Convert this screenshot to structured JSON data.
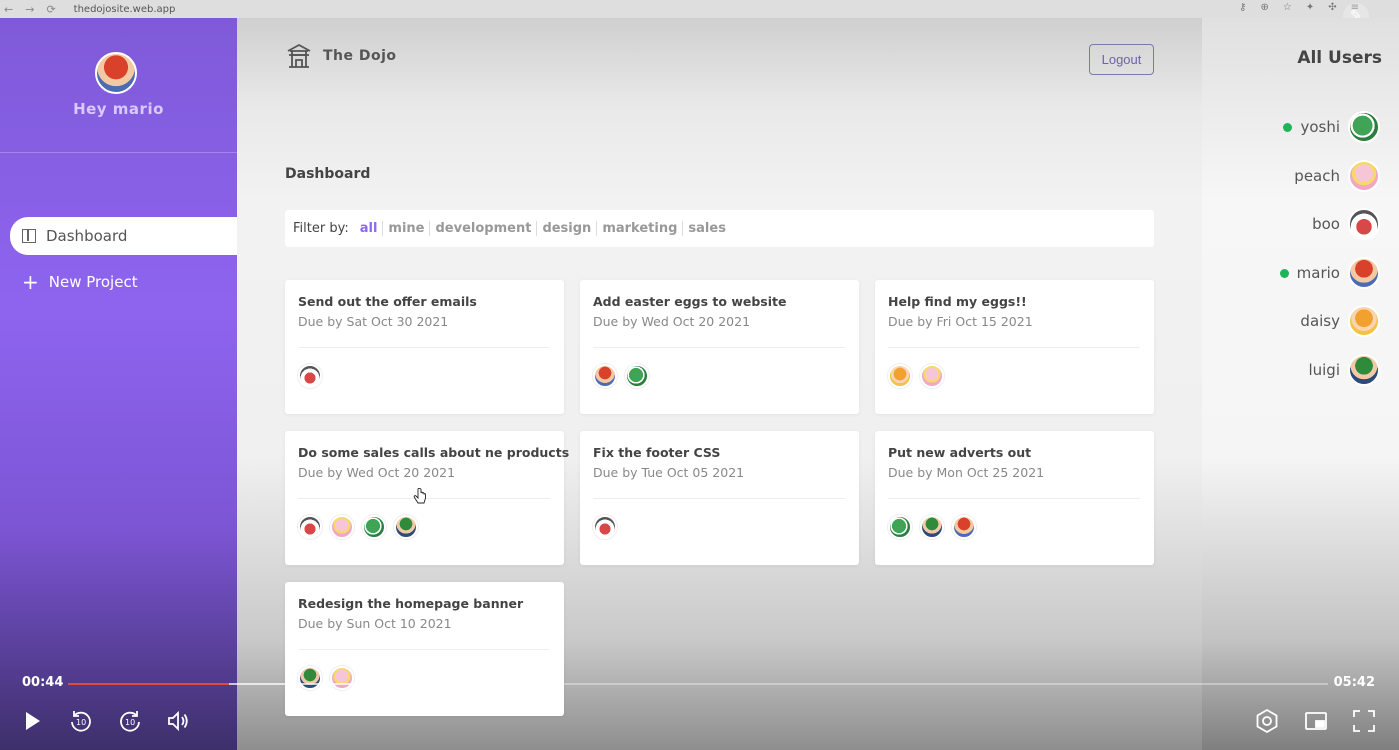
{
  "browser": {
    "url": "thedojosite.web.app"
  },
  "sidebar": {
    "greeting": "Hey mario",
    "nav": [
      {
        "label": "Dashboard",
        "icon": "dashboard-icon",
        "active": true
      },
      {
        "label": "New Project",
        "icon": "plus-icon",
        "active": false
      }
    ]
  },
  "header": {
    "brand": "The Dojo",
    "logout_label": "Logout"
  },
  "main": {
    "title": "Dashboard",
    "filter": {
      "label": "Filter by:",
      "options": [
        "all",
        "mine",
        "development",
        "design",
        "marketing",
        "sales"
      ],
      "active": "all"
    },
    "projects": [
      {
        "title": "Send out the offer emails",
        "due": "Due by Sat Oct 30 2021",
        "assigned": [
          "boo"
        ]
      },
      {
        "title": "Add easter eggs to website",
        "due": "Due by Wed Oct 20 2021",
        "assigned": [
          "mario",
          "yoshi"
        ]
      },
      {
        "title": "Help find my eggs!!",
        "due": "Due by Fri Oct 15 2021",
        "assigned": [
          "daisy",
          "peach"
        ]
      },
      {
        "title": "Do some sales calls about ne products",
        "due": "Due by Wed Oct 20 2021",
        "assigned": [
          "boo",
          "peach",
          "yoshi",
          "luigi"
        ]
      },
      {
        "title": "Fix the footer CSS",
        "due": "Due by Tue Oct 05 2021",
        "assigned": [
          "boo"
        ]
      },
      {
        "title": "Put new adverts out",
        "due": "Due by Mon Oct 25 2021",
        "assigned": [
          "yoshi",
          "luigi",
          "mario"
        ]
      },
      {
        "title": "Redesign the homepage banner",
        "due": "Due by Sun Oct 10 2021",
        "assigned": [
          "luigi",
          "peach"
        ]
      }
    ]
  },
  "users_panel": {
    "title": "All Users",
    "users": [
      {
        "name": "yoshi",
        "online": true
      },
      {
        "name": "peach",
        "online": false
      },
      {
        "name": "boo",
        "online": false
      },
      {
        "name": "mario",
        "online": true
      },
      {
        "name": "daisy",
        "online": false
      },
      {
        "name": "luigi",
        "online": false
      }
    ]
  },
  "player": {
    "current_time": "00:44",
    "total_time": "05:42",
    "played_fraction": 0.128,
    "buffered_fraction": 0.279,
    "controls": [
      "play-icon",
      "rewind-10-icon",
      "forward-10-icon",
      "volume-icon",
      "settings-icon",
      "picture-in-picture-icon",
      "fullscreen-icon"
    ]
  },
  "colors": {
    "accent": "#8d69f1",
    "online": "#1fb35a",
    "progress": "#e04a3c"
  }
}
